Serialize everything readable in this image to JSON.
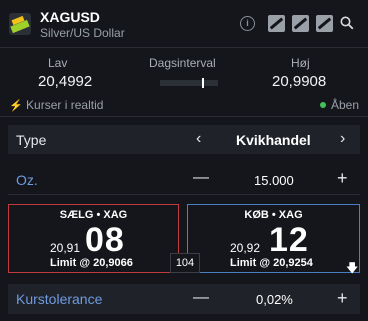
{
  "header": {
    "symbol": "XAGUSD",
    "description": "Silver/US Dollar",
    "info_glyph": "i",
    "icons": [
      "info-icon",
      "chart-icon",
      "chart-icon",
      "chart-icon",
      "search-icon"
    ]
  },
  "stats": {
    "low_label": "Lav",
    "low_value": "20,4992",
    "range_label": "Dagsinterval",
    "high_label": "Høj",
    "high_value": "20,9908"
  },
  "status": {
    "realtime": "Kurser i realtid",
    "market_state": "Åben"
  },
  "type_row": {
    "label": "Type",
    "value": "Kvikhandel"
  },
  "amount_row": {
    "label": "Oz.",
    "value": "15.000",
    "minus": "—",
    "plus": "+"
  },
  "sell": {
    "title": "SÆLG • XAG",
    "price_small": "20,91",
    "price_big": "08",
    "limit": "Limit @ 20,9066"
  },
  "buy": {
    "title": "KØB • XAG",
    "price_small": "20,92",
    "price_big": "12",
    "limit": "Limit @ 20,9254"
  },
  "spread": "104",
  "tolerance_row": {
    "label": "Kurstolerance",
    "value": "0,02%",
    "minus": "—",
    "plus": "+"
  },
  "colors": {
    "accent_blue": "#6f9be0",
    "sell_border": "#c0393c",
    "buy_border": "#4a7fc1",
    "status_green": "#45c05a"
  }
}
